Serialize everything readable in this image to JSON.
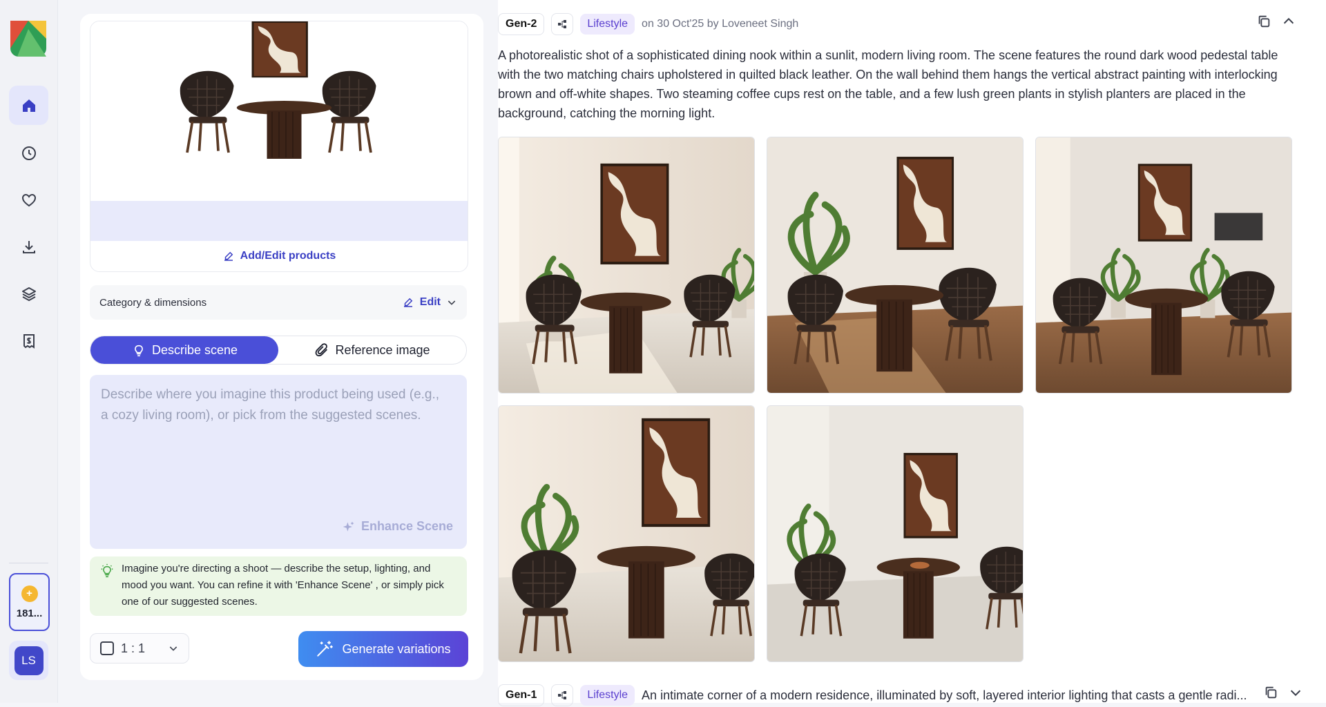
{
  "nav": {
    "items": [
      {
        "name": "home-icon",
        "active": true
      },
      {
        "name": "history-icon",
        "active": false
      },
      {
        "name": "heart-icon",
        "active": false
      },
      {
        "name": "download-icon",
        "active": false
      },
      {
        "name": "layers-icon",
        "active": false
      },
      {
        "name": "billing-icon",
        "active": false
      }
    ],
    "credits": "181...",
    "avatar_initials": "LS"
  },
  "left_panel": {
    "add_edit_label": "Add/Edit products",
    "category_label": "Category & dimensions",
    "category_edit_label": "Edit",
    "tabs": [
      "Describe scene",
      "Reference image"
    ],
    "active_tab": "Describe scene",
    "scene_placeholder": "Describe where you imagine this product being used (e.g., a cozy living room), or pick from the suggested scenes.",
    "enhance_label": "Enhance Scene",
    "tip_text": "Imagine you're directing a shoot — describe the setup, lighting, and mood you want. You can refine it with 'Enhance Scene' , or simply pick one of our suggested scenes.",
    "ratio_value": "1 : 1",
    "generate_label": "Generate variations"
  },
  "generations": [
    {
      "tag": "Gen-2",
      "category": "Lifestyle",
      "meta": "on 30 Oct'25 by Loveneet Singh",
      "description": "A photorealistic shot of a sophisticated dining nook within a sunlit, modern living room. The scene features the round dark wood pedestal table with the two matching chairs upholstered in quilted black leather. On the wall behind them hangs the vertical abstract painting with interlocking brown and off-white shapes. Two steaming coffee cups rest on the table, and a few lush green plants in stylish planters are placed in the background, catching the morning light.",
      "image_count": 5
    },
    {
      "tag": "Gen-1",
      "category": "Lifestyle",
      "description": "An intimate corner of a modern residence, illuminated by soft, layered interior lighting that casts a gentle radi..."
    }
  ],
  "colors": {
    "accent": "#4a4fd8",
    "tip_bg": "#ecf7e6",
    "scene_bg": "#e8eafb",
    "lifestyle_bg": "#eeeafd"
  }
}
